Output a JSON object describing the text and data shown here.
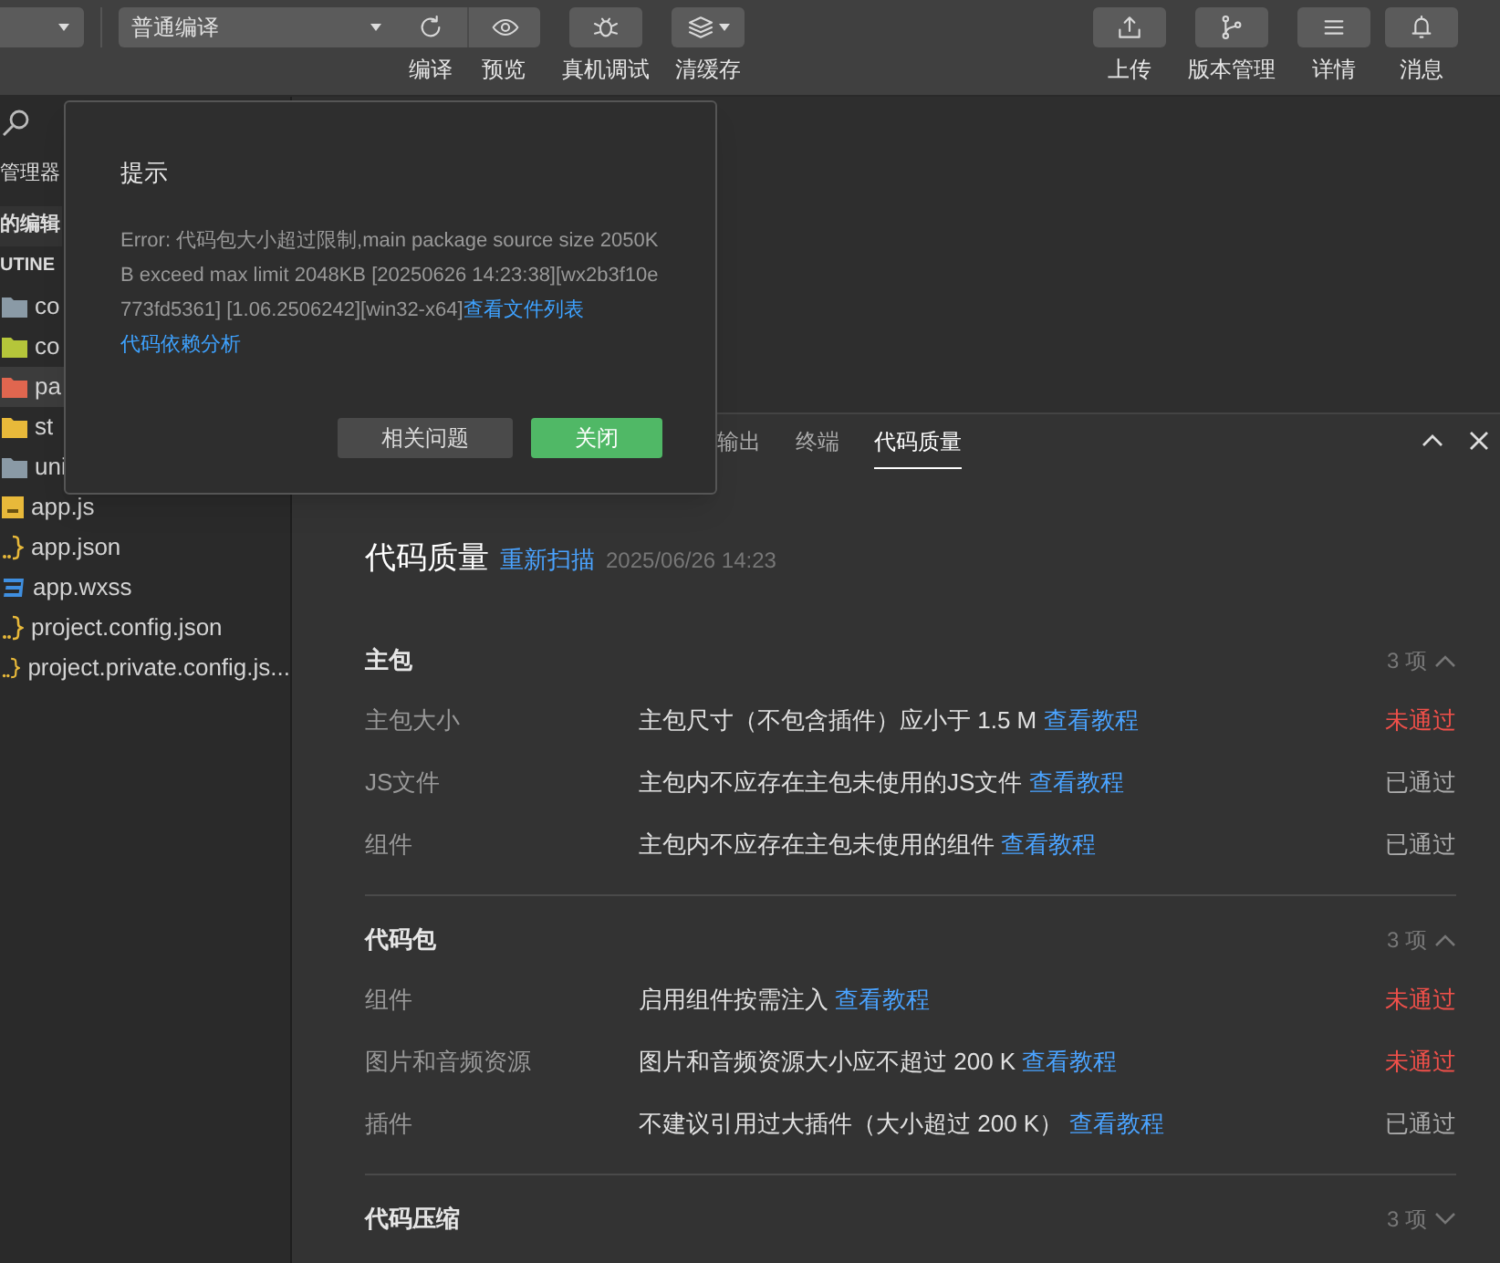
{
  "toolbar": {
    "compile_mode": {
      "value": "普通编译"
    },
    "left_buttons": [
      {
        "kind": "refresh",
        "label": "编译"
      },
      {
        "kind": "eye",
        "label": "预览"
      },
      {
        "kind": "bug",
        "label": "真机调试"
      },
      {
        "kind": "layers",
        "label": "清缓存"
      }
    ],
    "right_buttons": [
      {
        "kind": "upload",
        "label": "上传"
      },
      {
        "kind": "branch",
        "label": "版本管理"
      },
      {
        "kind": "menu",
        "label": "详情"
      },
      {
        "kind": "bell",
        "label": "消息"
      }
    ]
  },
  "sidebar": {
    "title": "管理器",
    "open_editors": "的编辑",
    "project": "UTINE",
    "items": [
      {
        "kind": "folder",
        "name": "co",
        "color": "#8a9aa6",
        "selected": false
      },
      {
        "kind": "folder",
        "name": "co",
        "color": "#b5c63a",
        "selected": false
      },
      {
        "kind": "folder",
        "name": "pa",
        "color": "#e0664f",
        "selected": true
      },
      {
        "kind": "folder",
        "name": "st",
        "color": "#e8b93a",
        "selected": false
      },
      {
        "kind": "folder",
        "name": "uni",
        "color": "#8a9aa6",
        "selected": false
      },
      {
        "kind": "js",
        "name": "app.js",
        "selected": false
      },
      {
        "kind": "json",
        "name": "app.json",
        "selected": false
      },
      {
        "kind": "wxss",
        "name": "app.wxss",
        "selected": false
      },
      {
        "kind": "json",
        "name": "project.config.json",
        "selected": false
      },
      {
        "kind": "json",
        "name": "project.private.config.js...",
        "selected": false
      }
    ]
  },
  "panel": {
    "tabs": [
      {
        "label": "输出",
        "selected": false
      },
      {
        "label": "终端",
        "selected": false
      },
      {
        "label": "代码质量",
        "selected": true
      }
    ],
    "title": "代码质量",
    "rescan": "重新扫描",
    "time": "2025/06/26 14:23",
    "sections": [
      {
        "name": "主包",
        "count": "3 项",
        "expanded": true,
        "rows": [
          {
            "label": "主包大小",
            "text": "主包尺寸（不包含插件）应小于 1.5 M",
            "link": "查看教程",
            "status": "未通过",
            "passed": false
          },
          {
            "label": "JS文件",
            "text": "主包内不应存在主包未使用的JS文件",
            "link": "查看教程",
            "status": "已通过",
            "passed": true
          },
          {
            "label": "组件",
            "text": "主包内不应存在主包未使用的组件",
            "link": "查看教程",
            "status": "已通过",
            "passed": true
          }
        ]
      },
      {
        "name": "代码包",
        "count": "3 项",
        "expanded": true,
        "rows": [
          {
            "label": "组件",
            "text": "启用组件按需注入",
            "link": "查看教程",
            "status": "未通过",
            "passed": false
          },
          {
            "label": "图片和音频资源",
            "text": "图片和音频资源大小应不超过 200 K",
            "link": "查看教程",
            "status": "未通过",
            "passed": false
          },
          {
            "label": "插件",
            "text": "不建议引用过大插件（大小超过 200 K）",
            "link": "查看教程",
            "status": "已通过",
            "passed": true
          }
        ]
      },
      {
        "name": "代码压缩",
        "count": "3 项",
        "expanded": false
      }
    ]
  },
  "dialog": {
    "title": "提示",
    "message": "Error: 代码包大小超过限制,main package source size 2050KB exceed max limit 2048KB [20250626 14:23:38][wx2b3f10e773fd5361] [1.06.2506242][win32-x64]",
    "links": [
      "查看文件列表",
      "代码依赖分析"
    ],
    "buttons": [
      {
        "kind": "secondary",
        "label": "相关问题"
      },
      {
        "kind": "primary",
        "label": "关闭"
      }
    ]
  }
}
